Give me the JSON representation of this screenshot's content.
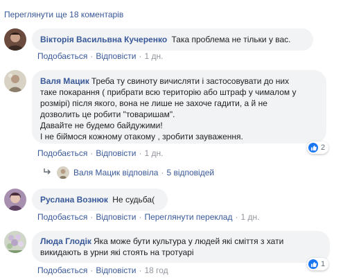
{
  "more_comments_label": "Переглянути ще 18 коментарів",
  "action_labels": {
    "like": "Подобається",
    "reply": "Відповісти",
    "see_translation": "Переглянути переклад"
  },
  "comments": [
    {
      "author": "Вікторія Васильвна Кучеренко",
      "text_lines": [
        "Така проблема не тільки у вас."
      ],
      "time": "1 дн."
    },
    {
      "author": "Валя Мацик",
      "text_lines": [
        "Треба ту свиноту вичисляти і застосовувати до них",
        "таке покарання ( прибрати всю територію або штраф у чималом у",
        "розмірі) після якого, вона не лише не захоче гадити, а й не",
        "дозволить це робити \"товаришам\".",
        "Давайте не будемо байдужими!",
        "І не біймося кожному отакому , зробити зауваження."
      ],
      "time": "1 дн.",
      "reactions": "2"
    },
    {
      "author": "Руслана Вознюк",
      "text_lines": [
        "Не судьба("
      ],
      "time": "1 дн."
    },
    {
      "author": "Люда Глодік",
      "text_lines": [
        "Яка може бути культура у людей які сміття з хати",
        "викидають в урни які стоять на тротуарі"
      ],
      "time": "18 год",
      "reactions": "1"
    }
  ],
  "replies_summary": {
    "author": "Валя Мацик",
    "verb": "відповіла",
    "count_label": "5 відповідей"
  },
  "colors": {
    "link": "#385898",
    "bubble": "#f2f3f5",
    "meta": "#90949c",
    "like_blue": "#1877f2"
  },
  "icons": [
    "reply-arrow-icon",
    "like-icon"
  ]
}
